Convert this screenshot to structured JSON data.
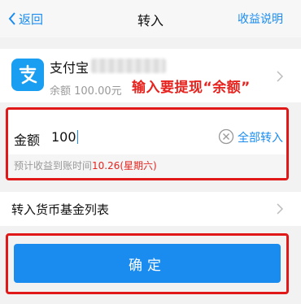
{
  "nav": {
    "back_label": "返回",
    "title": "转入",
    "right_label": "收益说明"
  },
  "account": {
    "name": "支付宝",
    "balance_text": "余额 100.00元",
    "icon": "alipay-icon",
    "brand_color": "#1a9ef1"
  },
  "annotation_text": "输入要提现“余额”",
  "amount": {
    "label": "金额",
    "value": "100",
    "all_in_label": "全部转入",
    "estimate_prefix": "预计收益到账时间",
    "estimate_date": "10.26(星期六)"
  },
  "fund_list": {
    "label": "转入货币基金列表"
  },
  "confirm": {
    "label": "确定"
  },
  "colors": {
    "accent": "#1a8cf0",
    "highlight": "#e6231e",
    "annotation_border": "#e01818"
  }
}
